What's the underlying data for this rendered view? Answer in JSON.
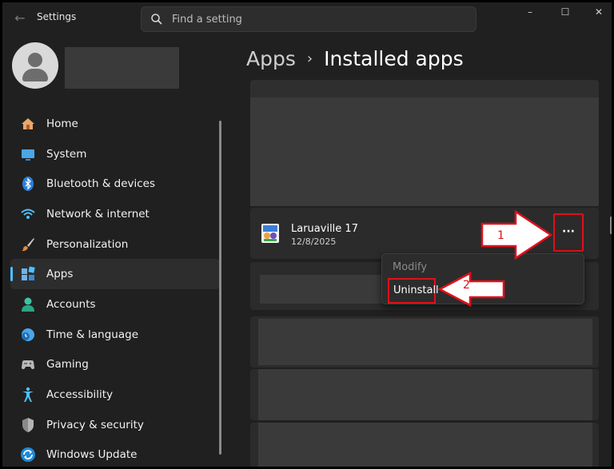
{
  "window": {
    "title": "Settings"
  },
  "search": {
    "placeholder": "Find a setting"
  },
  "titlebar": {
    "minimize": "–",
    "maximize": "☐",
    "close": "✕"
  },
  "sidebar": {
    "items": [
      {
        "label": "Home",
        "icon": "home-icon"
      },
      {
        "label": "System",
        "icon": "system-icon"
      },
      {
        "label": "Bluetooth & devices",
        "icon": "bluetooth-icon"
      },
      {
        "label": "Network & internet",
        "icon": "network-icon"
      },
      {
        "label": "Personalization",
        "icon": "brush-icon"
      },
      {
        "label": "Apps",
        "icon": "apps-icon",
        "active": true
      },
      {
        "label": "Accounts",
        "icon": "accounts-icon"
      },
      {
        "label": "Time & language",
        "icon": "time-language-icon"
      },
      {
        "label": "Gaming",
        "icon": "gaming-icon"
      },
      {
        "label": "Accessibility",
        "icon": "accessibility-icon"
      },
      {
        "label": "Privacy & security",
        "icon": "shield-icon"
      },
      {
        "label": "Windows Update",
        "icon": "update-icon"
      }
    ]
  },
  "breadcrumb": {
    "parent": "Apps",
    "separator": "›",
    "current": "Installed apps"
  },
  "app": {
    "name": "Laruaville 17",
    "date": "12/8/2025",
    "more": "···"
  },
  "context_menu": {
    "modify": "Modify",
    "uninstall": "Uninstall"
  },
  "annotations": {
    "step1": "1",
    "step2": "2"
  },
  "colors": {
    "accent": "#4cc2ff",
    "highlight": "#e0101a",
    "background": "#202020",
    "card": "#2b2b2b"
  }
}
